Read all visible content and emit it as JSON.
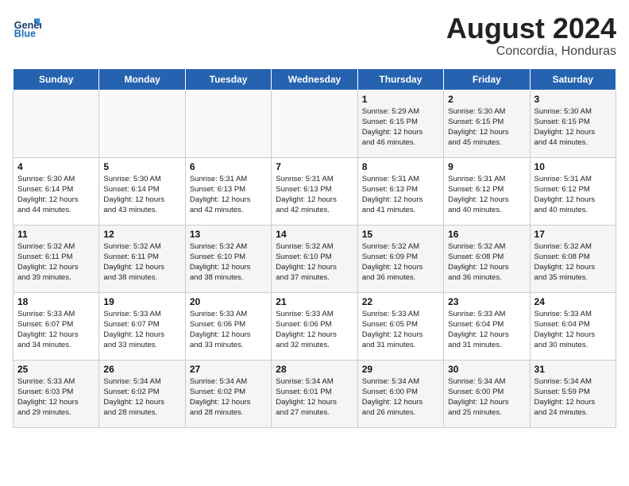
{
  "header": {
    "logo_general": "General",
    "logo_blue": "Blue",
    "month_year": "August 2024",
    "location": "Concordia, Honduras"
  },
  "days_of_week": [
    "Sunday",
    "Monday",
    "Tuesday",
    "Wednesday",
    "Thursday",
    "Friday",
    "Saturday"
  ],
  "weeks": [
    [
      {
        "num": "",
        "info": ""
      },
      {
        "num": "",
        "info": ""
      },
      {
        "num": "",
        "info": ""
      },
      {
        "num": "",
        "info": ""
      },
      {
        "num": "1",
        "info": "Sunrise: 5:29 AM\nSunset: 6:15 PM\nDaylight: 12 hours\nand 46 minutes."
      },
      {
        "num": "2",
        "info": "Sunrise: 5:30 AM\nSunset: 6:15 PM\nDaylight: 12 hours\nand 45 minutes."
      },
      {
        "num": "3",
        "info": "Sunrise: 5:30 AM\nSunset: 6:15 PM\nDaylight: 12 hours\nand 44 minutes."
      }
    ],
    [
      {
        "num": "4",
        "info": "Sunrise: 5:30 AM\nSunset: 6:14 PM\nDaylight: 12 hours\nand 44 minutes."
      },
      {
        "num": "5",
        "info": "Sunrise: 5:30 AM\nSunset: 6:14 PM\nDaylight: 12 hours\nand 43 minutes."
      },
      {
        "num": "6",
        "info": "Sunrise: 5:31 AM\nSunset: 6:13 PM\nDaylight: 12 hours\nand 42 minutes."
      },
      {
        "num": "7",
        "info": "Sunrise: 5:31 AM\nSunset: 6:13 PM\nDaylight: 12 hours\nand 42 minutes."
      },
      {
        "num": "8",
        "info": "Sunrise: 5:31 AM\nSunset: 6:13 PM\nDaylight: 12 hours\nand 41 minutes."
      },
      {
        "num": "9",
        "info": "Sunrise: 5:31 AM\nSunset: 6:12 PM\nDaylight: 12 hours\nand 40 minutes."
      },
      {
        "num": "10",
        "info": "Sunrise: 5:31 AM\nSunset: 6:12 PM\nDaylight: 12 hours\nand 40 minutes."
      }
    ],
    [
      {
        "num": "11",
        "info": "Sunrise: 5:32 AM\nSunset: 6:11 PM\nDaylight: 12 hours\nand 39 minutes."
      },
      {
        "num": "12",
        "info": "Sunrise: 5:32 AM\nSunset: 6:11 PM\nDaylight: 12 hours\nand 38 minutes."
      },
      {
        "num": "13",
        "info": "Sunrise: 5:32 AM\nSunset: 6:10 PM\nDaylight: 12 hours\nand 38 minutes."
      },
      {
        "num": "14",
        "info": "Sunrise: 5:32 AM\nSunset: 6:10 PM\nDaylight: 12 hours\nand 37 minutes."
      },
      {
        "num": "15",
        "info": "Sunrise: 5:32 AM\nSunset: 6:09 PM\nDaylight: 12 hours\nand 36 minutes."
      },
      {
        "num": "16",
        "info": "Sunrise: 5:32 AM\nSunset: 6:08 PM\nDaylight: 12 hours\nand 36 minutes."
      },
      {
        "num": "17",
        "info": "Sunrise: 5:32 AM\nSunset: 6:08 PM\nDaylight: 12 hours\nand 35 minutes."
      }
    ],
    [
      {
        "num": "18",
        "info": "Sunrise: 5:33 AM\nSunset: 6:07 PM\nDaylight: 12 hours\nand 34 minutes."
      },
      {
        "num": "19",
        "info": "Sunrise: 5:33 AM\nSunset: 6:07 PM\nDaylight: 12 hours\nand 33 minutes."
      },
      {
        "num": "20",
        "info": "Sunrise: 5:33 AM\nSunset: 6:06 PM\nDaylight: 12 hours\nand 33 minutes."
      },
      {
        "num": "21",
        "info": "Sunrise: 5:33 AM\nSunset: 6:06 PM\nDaylight: 12 hours\nand 32 minutes."
      },
      {
        "num": "22",
        "info": "Sunrise: 5:33 AM\nSunset: 6:05 PM\nDaylight: 12 hours\nand 31 minutes."
      },
      {
        "num": "23",
        "info": "Sunrise: 5:33 AM\nSunset: 6:04 PM\nDaylight: 12 hours\nand 31 minutes."
      },
      {
        "num": "24",
        "info": "Sunrise: 5:33 AM\nSunset: 6:04 PM\nDaylight: 12 hours\nand 30 minutes."
      }
    ],
    [
      {
        "num": "25",
        "info": "Sunrise: 5:33 AM\nSunset: 6:03 PM\nDaylight: 12 hours\nand 29 minutes."
      },
      {
        "num": "26",
        "info": "Sunrise: 5:34 AM\nSunset: 6:02 PM\nDaylight: 12 hours\nand 28 minutes."
      },
      {
        "num": "27",
        "info": "Sunrise: 5:34 AM\nSunset: 6:02 PM\nDaylight: 12 hours\nand 28 minutes."
      },
      {
        "num": "28",
        "info": "Sunrise: 5:34 AM\nSunset: 6:01 PM\nDaylight: 12 hours\nand 27 minutes."
      },
      {
        "num": "29",
        "info": "Sunrise: 5:34 AM\nSunset: 6:00 PM\nDaylight: 12 hours\nand 26 minutes."
      },
      {
        "num": "30",
        "info": "Sunrise: 5:34 AM\nSunset: 6:00 PM\nDaylight: 12 hours\nand 25 minutes."
      },
      {
        "num": "31",
        "info": "Sunrise: 5:34 AM\nSunset: 5:59 PM\nDaylight: 12 hours\nand 24 minutes."
      }
    ]
  ]
}
